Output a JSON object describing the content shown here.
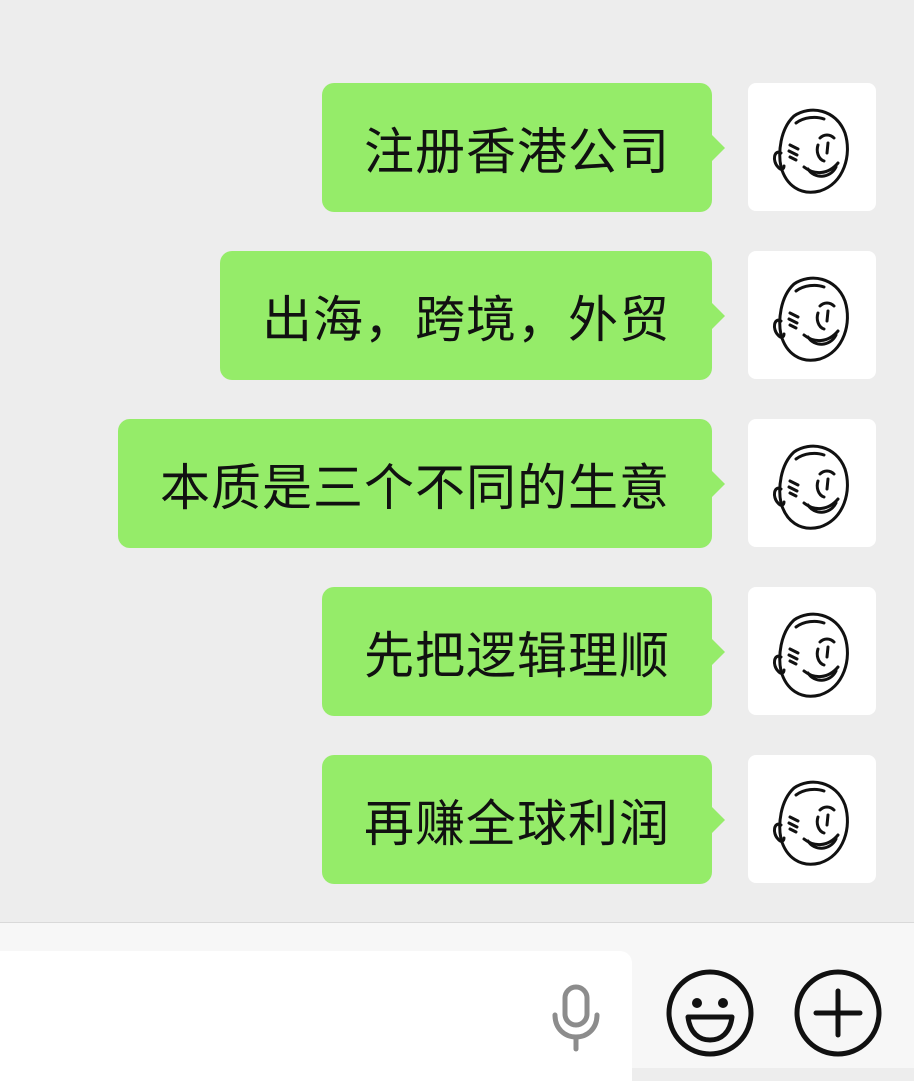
{
  "chat": {
    "messages": [
      {
        "text": "注册香港公司",
        "sender": "self"
      },
      {
        "text": "出海，跨境，外贸",
        "sender": "self"
      },
      {
        "text": "本质是三个不同的生意",
        "sender": "self"
      },
      {
        "text": "先把逻辑理顺",
        "sender": "self"
      },
      {
        "text": "再赚全球利润",
        "sender": "self"
      }
    ]
  },
  "input": {
    "value": "",
    "placeholder": ""
  },
  "icons": {
    "voice": "microphone-icon",
    "emoji": "smiley-face-icon",
    "more": "plus-circle-icon",
    "avatar": "cartoon-face-avatar"
  },
  "colors": {
    "chat_background": "#EDEDED",
    "bubble_self": "#95EC69",
    "input_bar": "#F7F7F7",
    "icon_stroke": "#111111",
    "mic_gray": "#8C8C8C"
  }
}
